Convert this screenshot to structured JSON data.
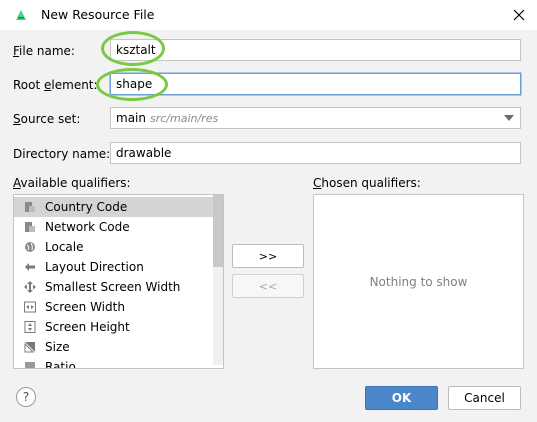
{
  "window": {
    "title": "New Resource File"
  },
  "form": {
    "file_name": {
      "label_u": "F",
      "label_rest": "ile name:",
      "value": "ksztalt"
    },
    "root_element": {
      "label_pre": "Root ",
      "label_u": "e",
      "label_rest": "lement:",
      "value": "shape"
    },
    "source_set": {
      "label_u": "S",
      "label_rest": "ource set:",
      "value": "main",
      "hint": "src/main/res"
    },
    "directory_name": {
      "label": "Directory name:",
      "value": "drawable"
    }
  },
  "available": {
    "label_u": "A",
    "label_rest": "vailable qualifiers:",
    "items": [
      {
        "label": "Country Code",
        "icon": "country-code-icon",
        "selected": true
      },
      {
        "label": "Network Code",
        "icon": "network-code-icon"
      },
      {
        "label": "Locale",
        "icon": "globe-icon"
      },
      {
        "label": "Layout Direction",
        "icon": "layout-direction-icon"
      },
      {
        "label": "Smallest Screen Width",
        "icon": "smallest-width-icon"
      },
      {
        "label": "Screen Width",
        "icon": "screen-width-icon"
      },
      {
        "label": "Screen Height",
        "icon": "screen-height-icon"
      },
      {
        "label": "Size",
        "icon": "size-icon"
      },
      {
        "label": "Ratio",
        "icon": "ratio-icon"
      }
    ]
  },
  "chosen": {
    "label_u": "C",
    "label_rest": "hosen qualifiers:",
    "empty_text": "Nothing to show"
  },
  "buttons": {
    "add": ">>",
    "remove": "<<",
    "ok": "OK",
    "cancel": "Cancel",
    "help": "?"
  },
  "colors": {
    "highlight_circle": "#7ac943",
    "primary": "#4a86c8",
    "android_green": "#3ddc84"
  }
}
